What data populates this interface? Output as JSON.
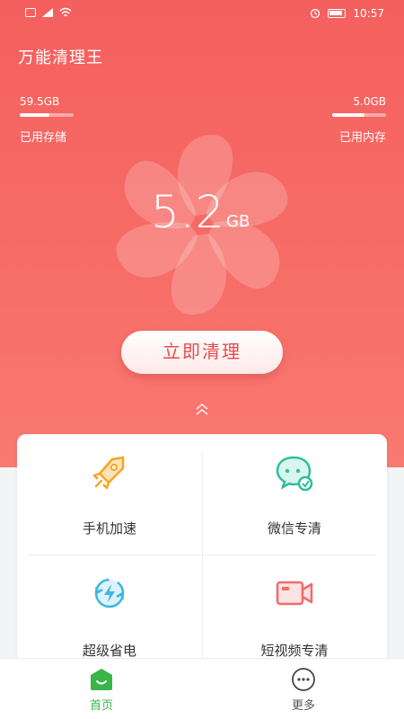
{
  "status_bar": {
    "time": "10:57"
  },
  "app": {
    "title": "万能清理王"
  },
  "storage": {
    "value": "59.5GB",
    "label": "已用存储",
    "fill_fraction": 0.55
  },
  "memory": {
    "value": "5.0GB",
    "label": "已用内存",
    "fill_fraction": 0.6
  },
  "junk": {
    "value": "5.2",
    "unit": "GB"
  },
  "clean_button": {
    "label": "立即清理"
  },
  "features": [
    {
      "label": "手机加速",
      "icon": "rocket-icon"
    },
    {
      "label": "微信专清",
      "icon": "wechat-icon"
    },
    {
      "label": "超级省电",
      "icon": "battery-saver-icon"
    },
    {
      "label": "短视频专清",
      "icon": "video-camera-icon"
    }
  ],
  "tabs": [
    {
      "label": "首页",
      "icon": "home-icon",
      "active": true
    },
    {
      "label": "更多",
      "icon": "more-icon",
      "active": false
    }
  ],
  "colors": {
    "hero": "#f4605e",
    "accent_green": "#39b54a",
    "button_text": "#e64b4b"
  }
}
